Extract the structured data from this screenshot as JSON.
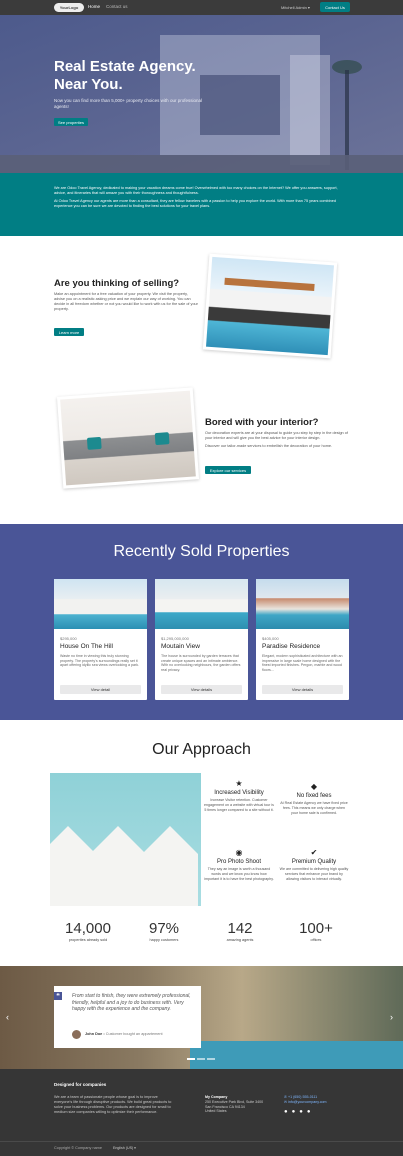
{
  "nav": {
    "logo": "YourLogo",
    "links": [
      "Home",
      "Contact us"
    ],
    "user": "Mitchell Admin ▾",
    "cta": "Contact Us"
  },
  "hero": {
    "title_line1": "Real Estate Agency.",
    "title_line2": "Near You.",
    "subtitle": "Now you can find more than 5,000+ property choices with our professional agents!",
    "button": "See properties"
  },
  "intro": {
    "p1": "We are Odoo Travel Agency, dedicated to making your vacation dreams come true! Overwhelmed with too many choices on the Internet? We offer you answers, support, advice, and itineraries that will amaze you with their thoroughness and thoughtfulness.",
    "p2": "At Odoo Travel Agency our agents are more than a consultant, they are fellow travelers with a passion to help you explore the world. With more than 75 years combined experience you can be sure we are devoted to finding the best solutions for your travel plans."
  },
  "selling": {
    "title": "Are you thinking of selling?",
    "text": "Make an appointment for a free valuation of your property. We visit the property, advise you on a realistic asking price and we explain our way of working. You can decide in all freedom whether or not you would like to work with us for the sale of your property.",
    "button": "Learn more"
  },
  "interior": {
    "title": "Bored with your interior?",
    "text1": "Our decoration experts are at your disposal to guide you step by step in the design of your interior and will give you the best advice for your interior design.",
    "text2": "Discover our tailor-made services to embellish the decoration of your home.",
    "button": "Explore our services"
  },
  "sold": {
    "title": "Recently Sold Properties",
    "cards": [
      {
        "price": "$295,000",
        "name": "House On The Hill",
        "desc": "Waste no time in viewing this truly stunning property. The property's surroundings really set it apart offering idyllic sea views overlooking a park.",
        "button": "View detail"
      },
      {
        "price": "$1,295,000,000",
        "name": "Moutain View",
        "desc": "The house is surrounded by garden terraces that create unique spaces and an intimate ambience. With no overlooking neighbours, the garden offers real privacy.",
        "button": "View details"
      },
      {
        "price": "$405,000",
        "name": "Paradise Residence",
        "desc": "Elegant, modern sophisticated architecture with an impressive in large scale home designed with the finest imported finishes. Pergon, marble and wood floors...",
        "button": "View details"
      }
    ]
  },
  "approach": {
    "title": "Our Approach",
    "features": [
      {
        "icon": "star-icon",
        "glyph": "★",
        "title": "Increased Visibility",
        "text": "Increase Visitor retention. Customer engagement on a website with virtual tour is 5 times longer compared to a site without it."
      },
      {
        "icon": "tag-icon",
        "glyph": "◆",
        "title": "No fixed fees",
        "text": "At Real Estate Agency we have fixed price fees. This means we only charge when your home sale is confirmed."
      },
      {
        "icon": "camera-icon",
        "glyph": "◉",
        "title": "Pro Photo Shoot",
        "text": "They say an image is worth a thousand words and we know you know how important it is to have the best photography."
      },
      {
        "icon": "check-icon",
        "glyph": "✔",
        "title": "Premium Quality",
        "text": "We are committed to delivering high quality services that enhance your brand by allowing visitors to interact virtually."
      }
    ],
    "stats": [
      {
        "value": "14,000",
        "label": "properties already sold"
      },
      {
        "value": "97%",
        "label": "happy customers"
      },
      {
        "value": "142",
        "label": "amazing agents"
      },
      {
        "value": "100+",
        "label": "offices"
      }
    ]
  },
  "testimonial": {
    "quote": "From start to finish, they were extremely professional, friendly, helpful and a joy to do business with. Very happy with the experience and the company.",
    "author": "John Doe",
    "author_note": " • Customer bought an appartement",
    "prev": "‹",
    "next": "›"
  },
  "footer": {
    "heading": "Designed for companies",
    "about": "We are a team of passionate people whose goal is to improve everyone's life through disruptive products. We build great products to solve your business problems. Our products are designed for small to medium size companies willing to optimize their performance.",
    "company": "My Company",
    "address1": "250 Executive Park Blvd, Suite 3400",
    "address2": "San Francisco CA 94134",
    "address3": "United States",
    "phone": "+1 (650) 555-0111",
    "email": "info@yourcompany.com",
    "copyright": "Copyright © Company name",
    "language": "English (US) ▾"
  }
}
